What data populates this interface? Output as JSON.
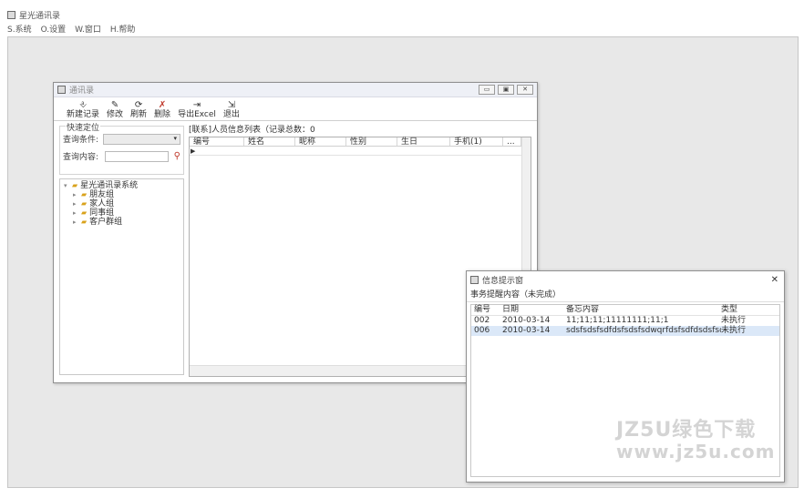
{
  "app": {
    "title": "星光通讯录",
    "menu": [
      "S.系统",
      "O.设置",
      "W.窗口",
      "H.帮助"
    ]
  },
  "address_window": {
    "title": "通讯录",
    "buttons": {
      "minimize": "▭",
      "maximize": "▣",
      "close": "✕"
    },
    "toolbar": [
      {
        "label": "新建记录",
        "icon": "new-record-icon",
        "glyph": "⎀"
      },
      {
        "label": "修改",
        "icon": "edit-icon",
        "glyph": "✎"
      },
      {
        "label": "刷新",
        "icon": "refresh-icon",
        "glyph": "⟳"
      },
      {
        "label": "删除",
        "icon": "delete-icon",
        "glyph": "✗"
      },
      {
        "label": "导出Excel",
        "icon": "export-icon",
        "glyph": "⇥"
      },
      {
        "label": "退出",
        "icon": "exit-icon",
        "glyph": "⇲"
      }
    ],
    "query": {
      "legend": "快速定位",
      "condition_label": "查询条件:",
      "content_label": "查询内容:",
      "condition_value": ""
    },
    "tree": {
      "root": "星光通讯录系统",
      "children": [
        "朋友组",
        "家人组",
        "同事组",
        "客户群组"
      ]
    },
    "list": {
      "caption": "[联系]人员信息列表（记录总数：0",
      "columns": [
        "编号",
        "姓名",
        "昵称",
        "性别",
        "生日",
        "手机(1)",
        "..."
      ]
    }
  },
  "reminder": {
    "title": "信息提示窗",
    "subtitle": "事务提醒内容（未完成）",
    "columns": [
      "编号",
      "日期",
      "备忘内容",
      "类型"
    ],
    "rows": [
      {
        "id": "002",
        "date": "2010-03-14",
        "content": "11;11;11;11111111;11;1",
        "type": "未执行"
      },
      {
        "id": "006",
        "date": "2010-03-14",
        "content": "sdsfsdsfsdfdsfsdsfsdwqrfdsfsdfdsdsfsd",
        "type": "未执行"
      }
    ]
  },
  "watermark": {
    "line1": "JZ5U绿色下载",
    "line2": "www.jz5u.com"
  }
}
